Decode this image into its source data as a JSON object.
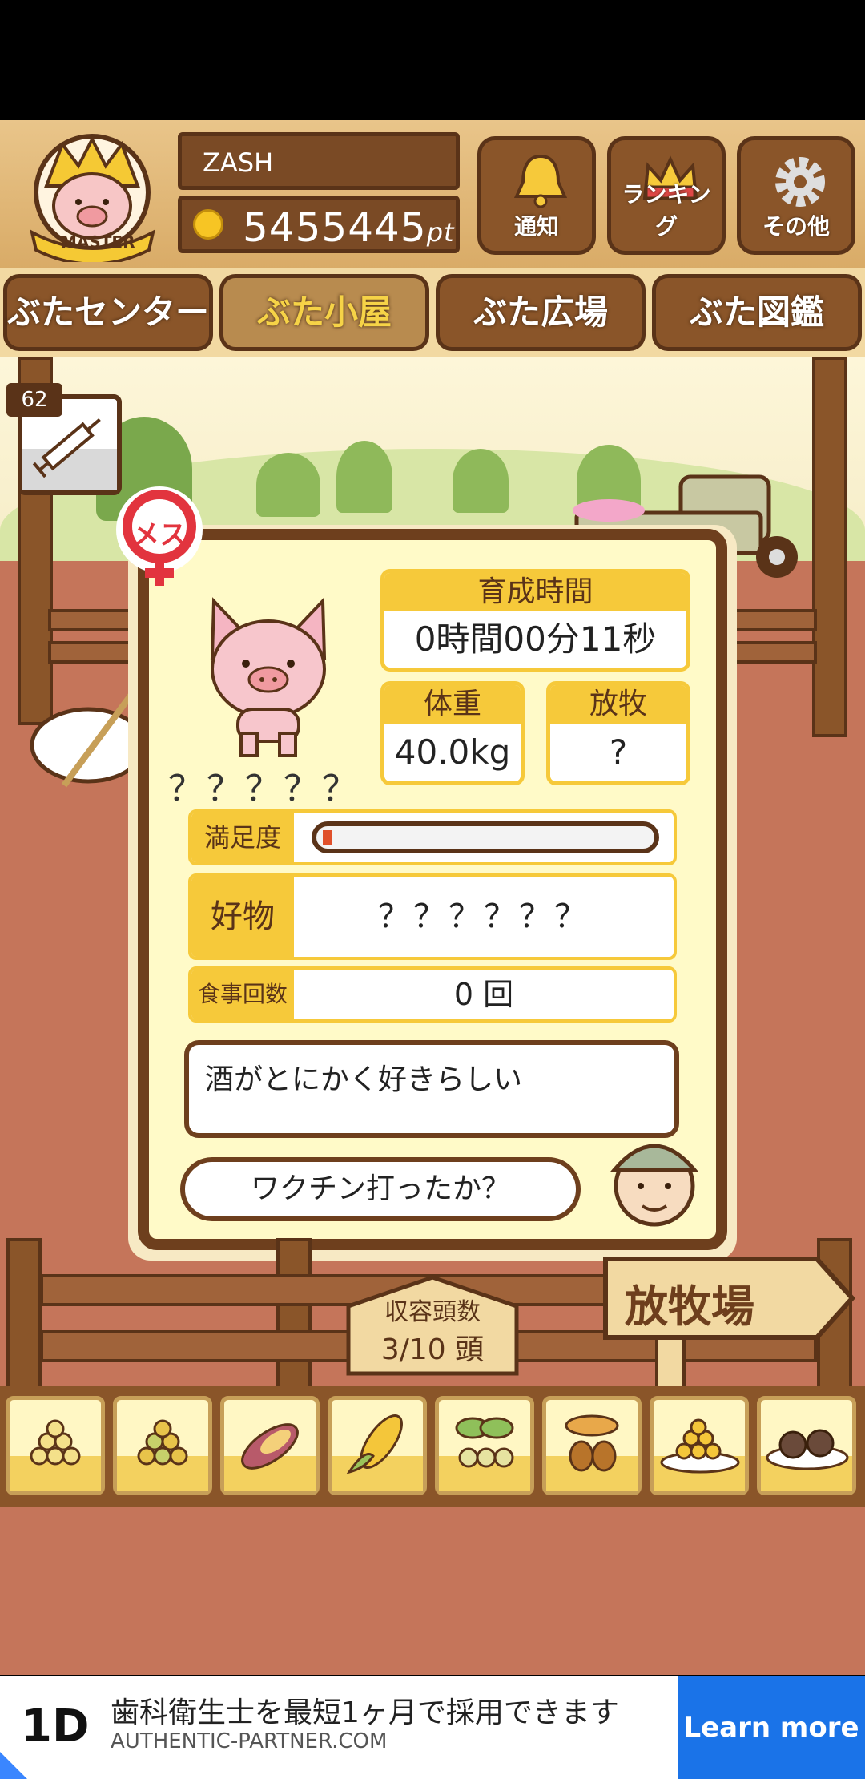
{
  "header": {
    "badge_label": "MASTER",
    "username": "ZASH",
    "points": "5455445",
    "points_unit": "pt",
    "buttons": [
      {
        "label": "通知",
        "icon": "bell-icon"
      },
      {
        "label": "ランキング",
        "icon": "crown-icon"
      },
      {
        "label": "その他",
        "icon": "gear-icon"
      }
    ]
  },
  "tabs": [
    {
      "label": "ぶたセンター",
      "active": false
    },
    {
      "label": "ぶた小屋",
      "active": true
    },
    {
      "label": "ぶた広場",
      "active": false
    },
    {
      "label": "ぶた図鑑",
      "active": false
    }
  ],
  "vaccine": {
    "count": "62",
    "icon": "syringe-icon"
  },
  "pig": {
    "gender_label": "メス",
    "name": "？？？？？",
    "raise_time_label": "育成時間",
    "raise_time_value": "0時間00分11秒",
    "weight_label": "体重",
    "weight_value": "40.0kg",
    "pasture_label": "放牧",
    "pasture_value": "?",
    "satisfaction_label": "満足度",
    "satisfaction_fraction": 0.03,
    "favorite_label": "好物",
    "favorite_value": "？？？？？？",
    "meals_label": "食事回数",
    "meals_value": "0 回",
    "hint_text": "酒がとにかく好きらしい",
    "speech_text": "ワクチン打ったか？"
  },
  "capacity": {
    "label": "収容頭数",
    "value": "3/10 頭"
  },
  "pasture_sign": "放牧場",
  "foods": [
    "grain-pile-icon",
    "mixed-grain-icon",
    "sweet-potato-icon",
    "corn-icon",
    "bean-sprout-icon",
    "acorn-icon",
    "grain-plate-icon",
    "meatball-plate-icon"
  ],
  "ad": {
    "logo": "1D",
    "title": "歯科衛生士を最短1ヶ月で採用できます",
    "url": "AUTHENTIC-PARTNER.COM",
    "cta": "Learn more"
  },
  "colors": {
    "wood_dark": "#5a3318",
    "wood": "#8a5529",
    "panel_yellow": "#fffac8",
    "accent_yellow": "#f6c93a",
    "ground": "#c5755a",
    "ad_blue": "#1a73e8"
  }
}
